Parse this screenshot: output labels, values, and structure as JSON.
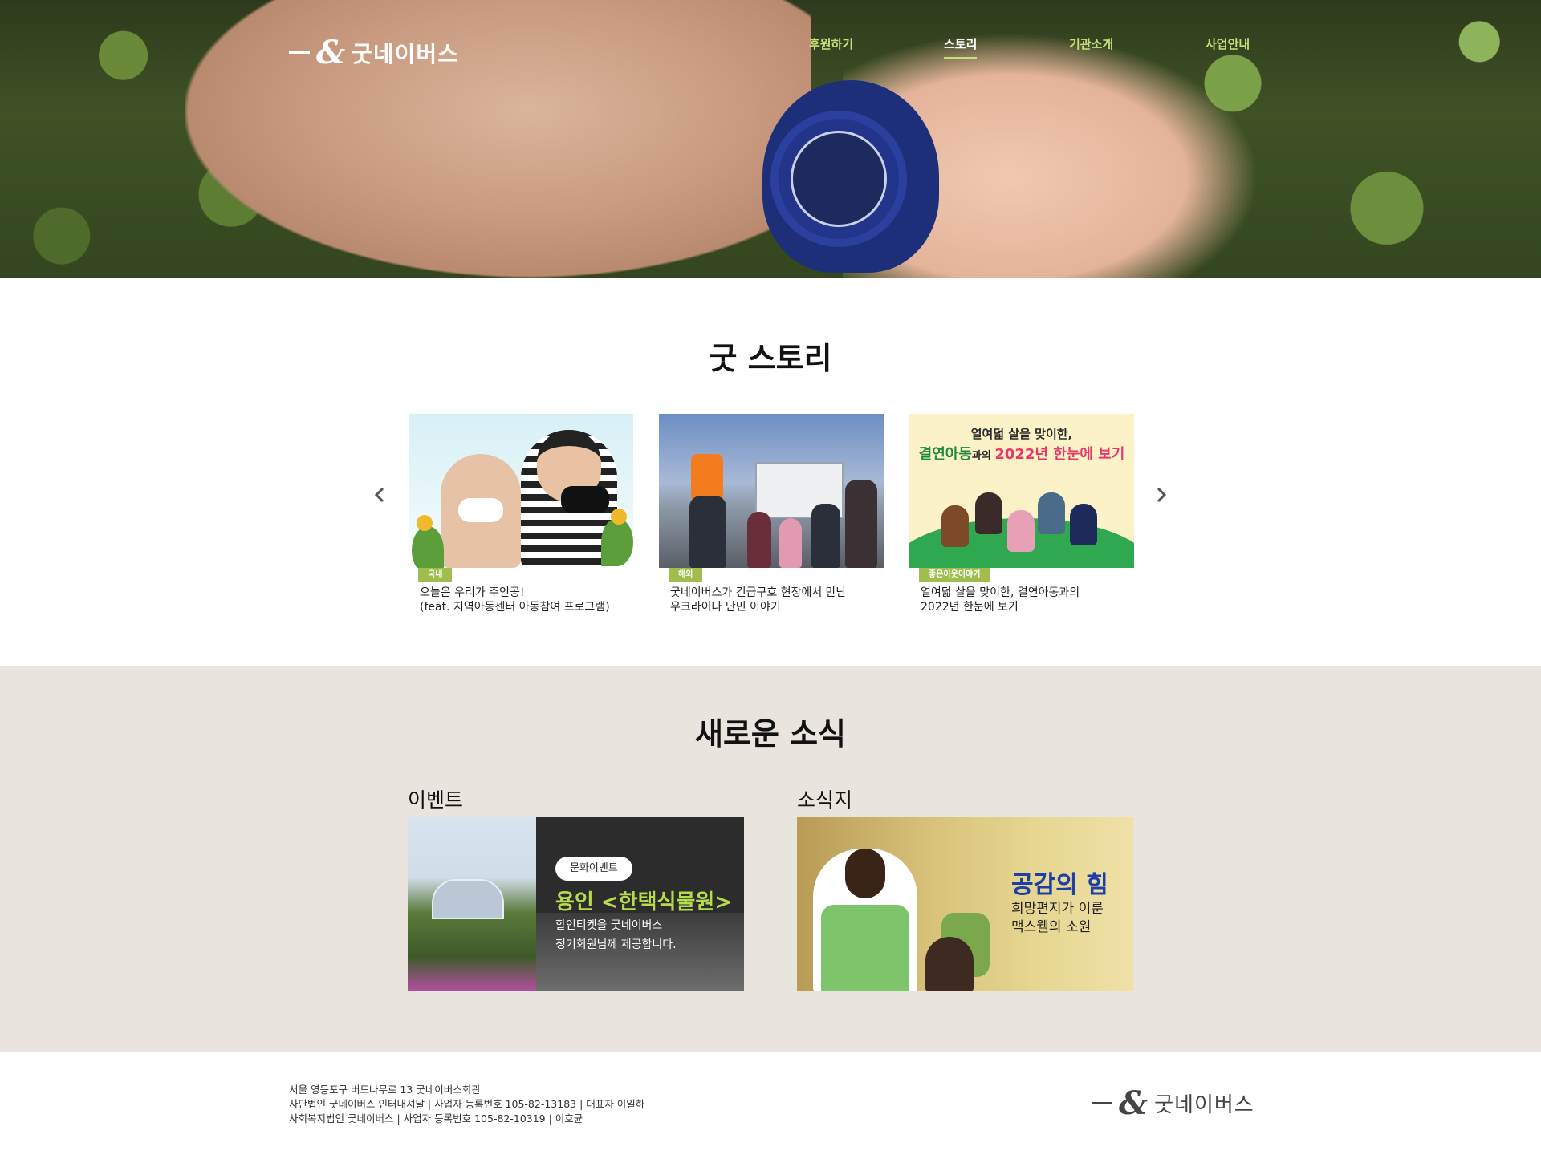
{
  "brand": {
    "name": "굿네이버스",
    "mark": "&"
  },
  "nav": [
    {
      "label": "후원하기",
      "active": false
    },
    {
      "label": "스토리",
      "active": true
    },
    {
      "label": "기관소개",
      "active": false
    },
    {
      "label": "사업안내",
      "active": false
    }
  ],
  "good_story": {
    "title": "굿 스토리",
    "prev_icon": "chevron-left-icon",
    "next_icon": "chevron-right-icon",
    "cards": [
      {
        "tag": "국내",
        "line1": "오늘은 우리가 주인공!",
        "line2": "(feat. 지역아동센터 아동참여 프로그램)"
      },
      {
        "tag": "해외",
        "line1": "굿네이버스가 긴급구호 현장에서 만난",
        "line2": "우크라이나 난민 이야기"
      },
      {
        "tag": "좋은이웃이야기",
        "line1": "열여덟 살을 맞이한, 결연아동과의",
        "line2": "2022년 한눈에 보기",
        "image_heading1": "열여덟 살을 맞이한,",
        "image_heading2_a": "결연아동",
        "image_heading2_b": "과의 ",
        "image_heading2_c": "2022년 한눈에 보기"
      }
    ]
  },
  "news": {
    "title": "새로운 소식",
    "event": {
      "label": "이벤트",
      "chip": "문화이벤트",
      "headline": "용인 <한택식물원>",
      "sub1": "할인티켓을 굿네이버스",
      "sub2": "정기회원님께 제공합니다."
    },
    "newsletter": {
      "label": "소식지",
      "headline": "공감의 힘",
      "sub1": "희망편지가 이룬",
      "sub2": "맥스웰의 소원"
    }
  },
  "footer": {
    "line1": "서울 영등포구 버드나무로 13 굿네이버스회관",
    "line2": "사단법인 굿네이버스 인터내셔날 | 사업자 등록번호 105-82-13183 | 대표자 이일하",
    "line3": "사회복지법인 굿네이버스 | 사업자 등록번호 105-82-10319 | 이호균"
  },
  "colors": {
    "accent_green": "#9fbe4d",
    "nav_green": "#c5e07a",
    "news_bg": "#e9e4de",
    "newsletter_blue": "#1f3fa8"
  }
}
